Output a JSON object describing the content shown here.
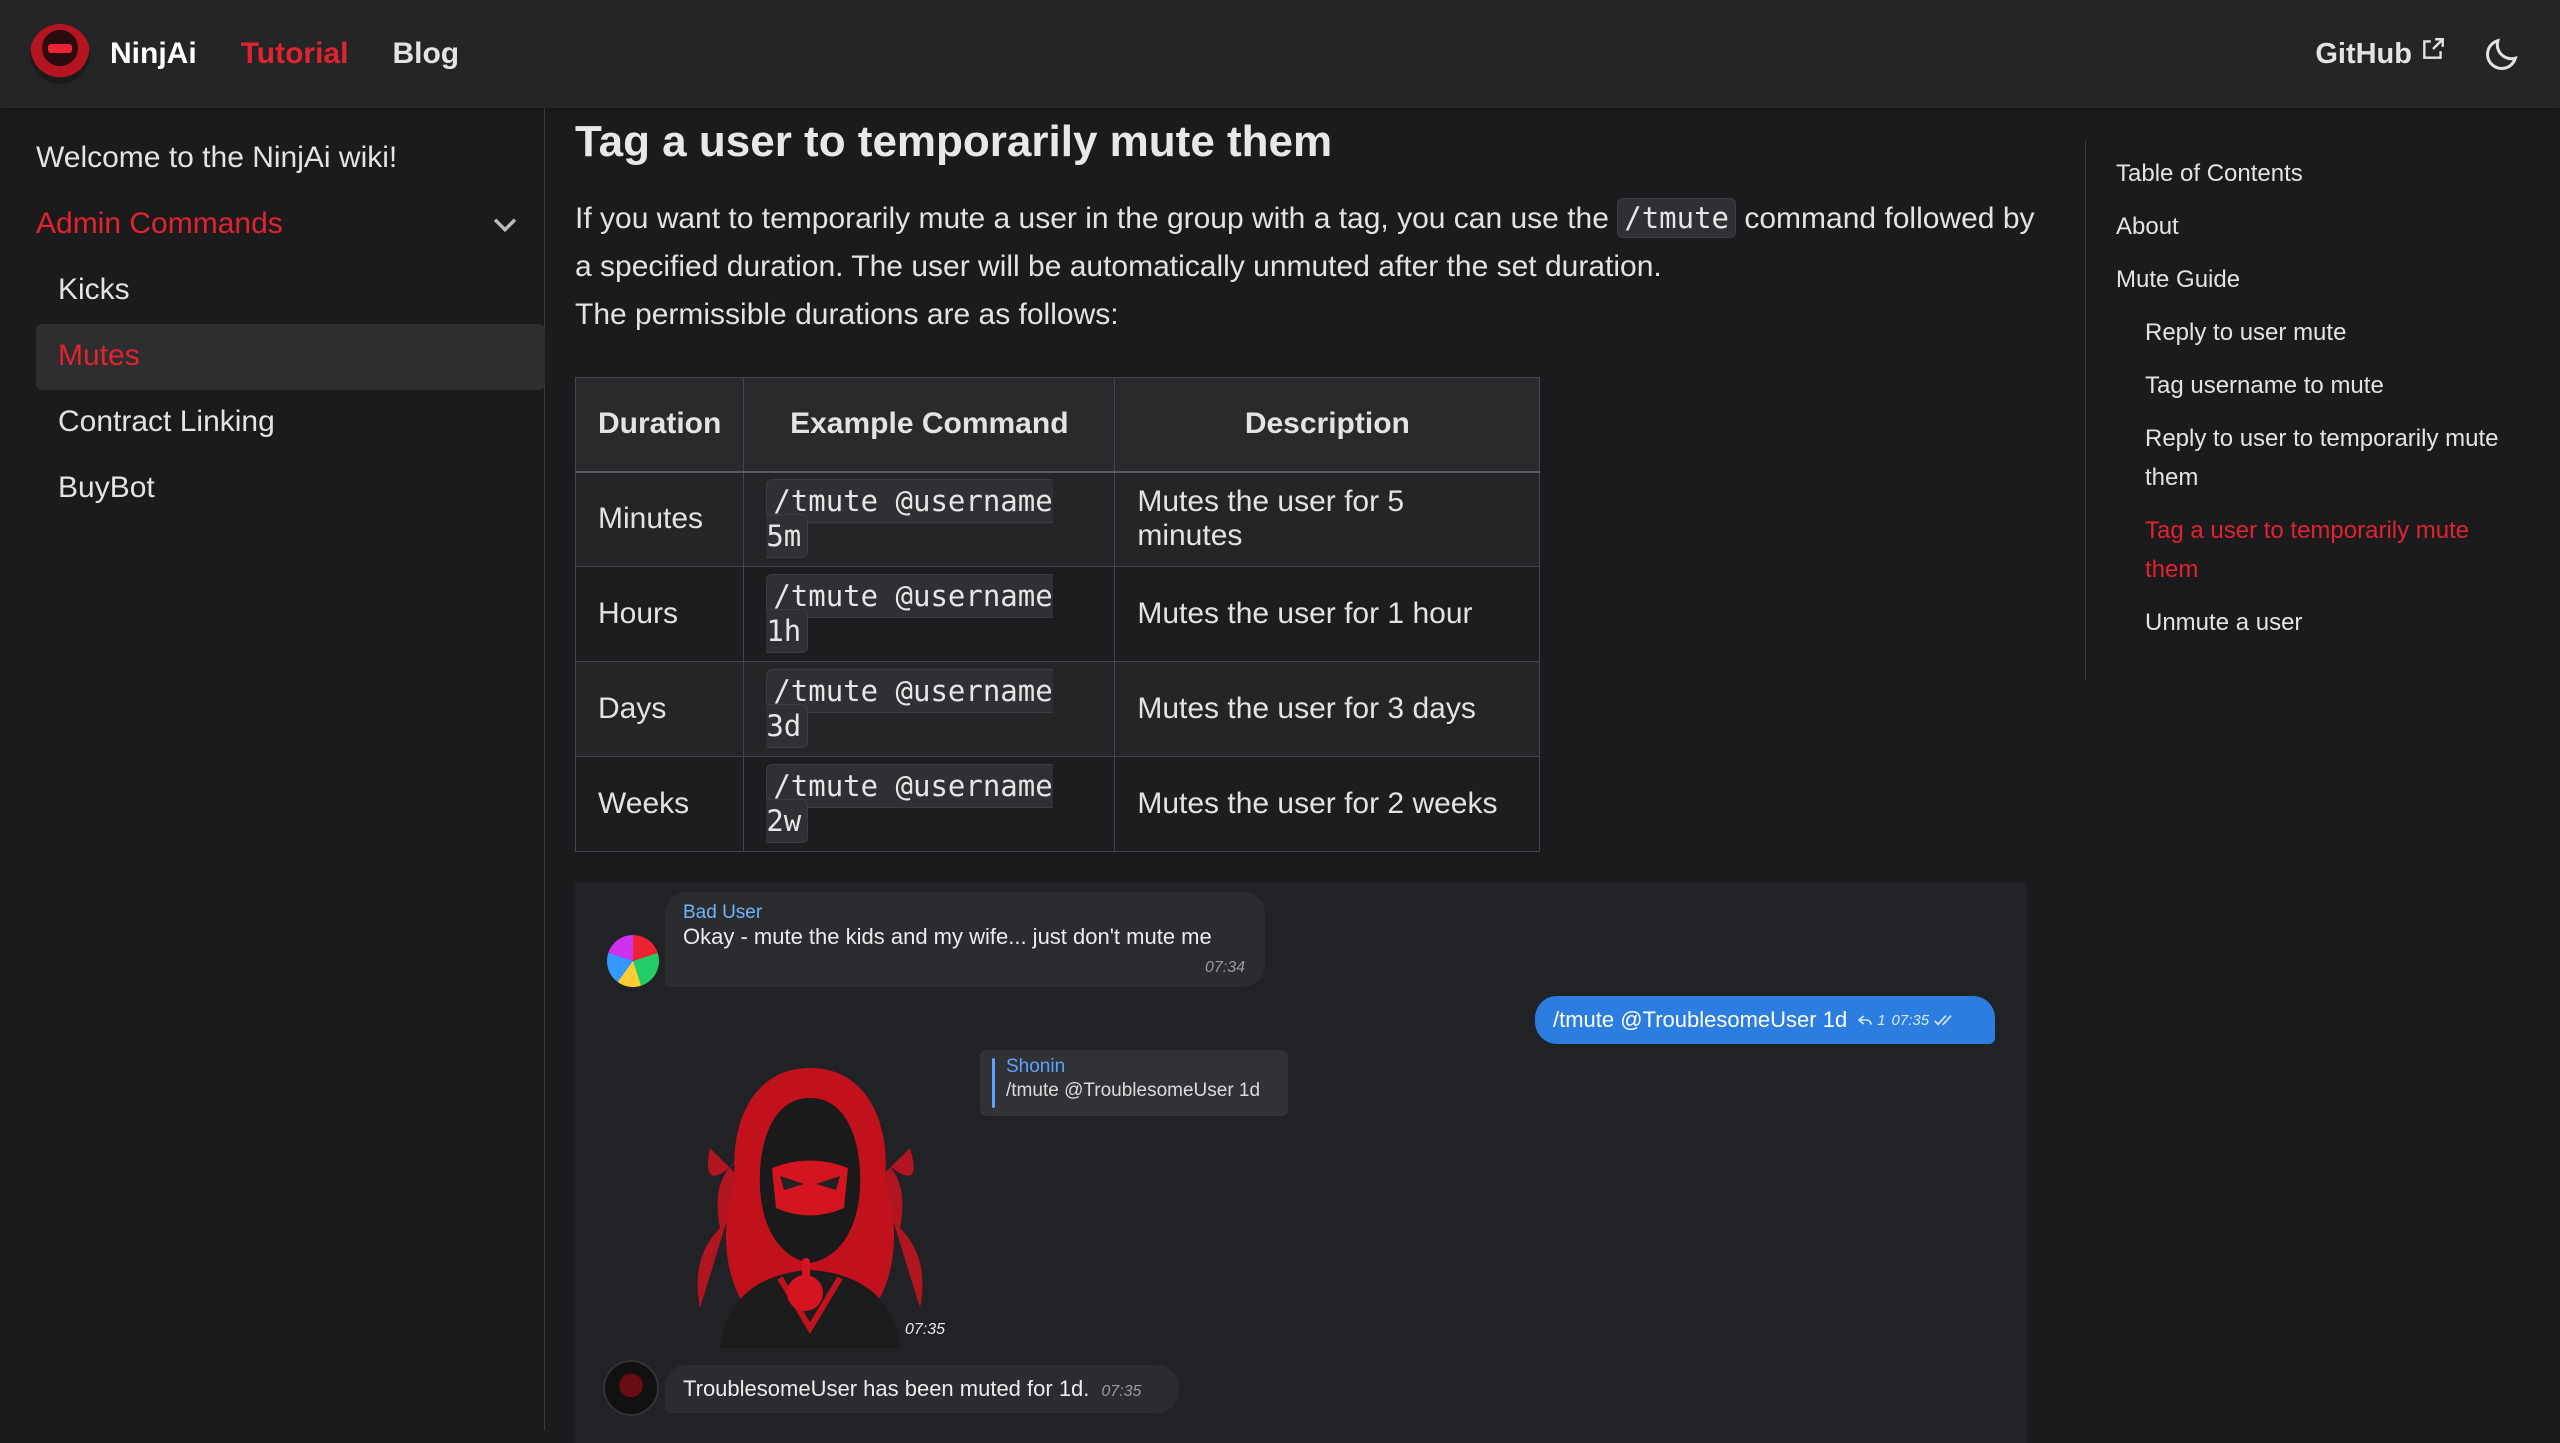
{
  "navbar": {
    "brand": "NinjAi",
    "links": [
      {
        "label": "Tutorial",
        "active": true
      },
      {
        "label": "Blog",
        "active": false
      }
    ],
    "github_label": "GitHub",
    "accent_color": "#e0232e"
  },
  "sidebar": {
    "welcome": "Welcome to the NinjAi wiki!",
    "category": "Admin Commands",
    "items": [
      {
        "label": "Kicks",
        "active": false
      },
      {
        "label": "Mutes",
        "active": true
      },
      {
        "label": "Contract Linking",
        "active": false
      },
      {
        "label": "BuyBot",
        "active": false
      }
    ]
  },
  "main": {
    "title": "Tag a user to temporarily mute them",
    "para_before": "If you want to temporarily mute a user in the group with a tag, you can use the",
    "para_code": "/tmute",
    "para_after": "command followed by a specified duration. The user will be automatically unmuted after the set duration.",
    "para2": "The permissible durations are as follows:",
    "table": {
      "headers": [
        "Duration",
        "Example Command",
        "Description"
      ],
      "rows": [
        {
          "duration": "Minutes",
          "command": "/tmute @username 5m",
          "description": "Mutes the user for 5 minutes"
        },
        {
          "duration": "Hours",
          "command": "/tmute @username 1h",
          "description": "Mutes the user for 1 hour"
        },
        {
          "duration": "Days",
          "command": "/tmute @username 3d",
          "description": "Mutes the user for 3 days"
        },
        {
          "duration": "Weeks",
          "command": "/tmute @username 2w",
          "description": "Mutes the user for 2 weeks"
        }
      ]
    }
  },
  "chat": {
    "msg1": {
      "sender": "Bad User",
      "text": "Okay - mute the kids and my wife... just don't mute me",
      "time": "07:34"
    },
    "msg2": {
      "text": "/tmute @TroublesomeUser 1d",
      "reply_count": "1",
      "time": "07:35"
    },
    "reply": {
      "sender": "Shonin",
      "text": "/tmute @TroublesomeUser 1d"
    },
    "sticker_time": "07:35",
    "msg3": {
      "text": "TroublesomeUser has been muted for 1d.",
      "time": "07:35"
    }
  },
  "toc": {
    "items": [
      {
        "label": "Table of Contents",
        "sub": false,
        "active": false
      },
      {
        "label": "About",
        "sub": false,
        "active": false
      },
      {
        "label": "Mute Guide",
        "sub": false,
        "active": false
      },
      {
        "label": "Reply to user mute",
        "sub": true,
        "active": false
      },
      {
        "label": "Tag username to mute",
        "sub": true,
        "active": false
      },
      {
        "label": "Reply to user to temporarily mute them",
        "sub": true,
        "active": false
      },
      {
        "label": "Tag a user to temporarily mute them",
        "sub": true,
        "active": true
      },
      {
        "label": "Unmute a user",
        "sub": true,
        "active": false
      }
    ]
  }
}
